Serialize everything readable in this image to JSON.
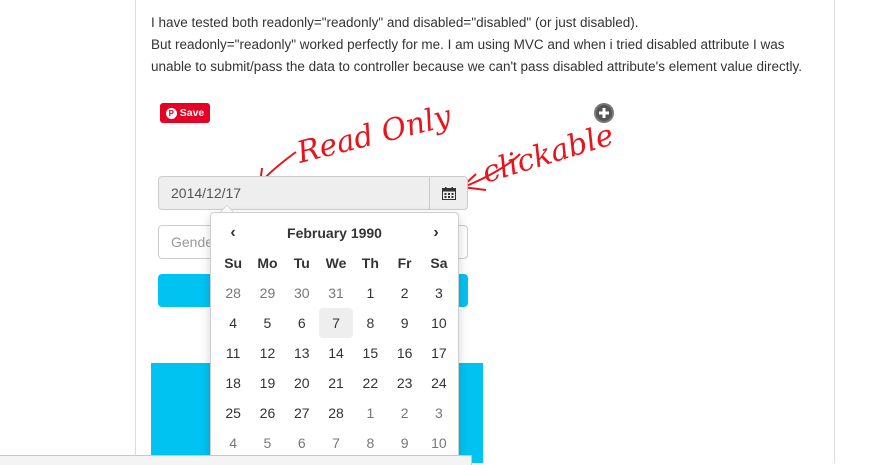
{
  "article": {
    "paragraph1": "I have tested both readonly=\"readonly\" and disabled=\"disabled\" (or just disabled).",
    "paragraph2": "But readonly=\"readonly\" worked perfectly for me. I am using MVC and when i tried disabled attribute I was unable to submit/pass the data to controller because we can't pass disabled attribute's element value directly."
  },
  "pinterest": {
    "label": "Save",
    "logo": "P"
  },
  "annotations": {
    "read_only": "Read Only",
    "clickable": "clickable"
  },
  "form": {
    "date_value": "2014/12/17",
    "gender_placeholder": "Gender",
    "calendar_icon": "calendar-icon"
  },
  "datepicker": {
    "prev": "‹",
    "next": "›",
    "title": "February 1990",
    "weekdays": [
      "Su",
      "Mo",
      "Tu",
      "We",
      "Th",
      "Fr",
      "Sa"
    ],
    "weeks": [
      [
        {
          "d": "28",
          "o": true
        },
        {
          "d": "29",
          "o": true
        },
        {
          "d": "30",
          "o": true
        },
        {
          "d": "31",
          "o": true
        },
        {
          "d": "1"
        },
        {
          "d": "2"
        },
        {
          "d": "3"
        }
      ],
      [
        {
          "d": "4"
        },
        {
          "d": "5"
        },
        {
          "d": "6"
        },
        {
          "d": "7",
          "hl": true
        },
        {
          "d": "8"
        },
        {
          "d": "9"
        },
        {
          "d": "10"
        }
      ],
      [
        {
          "d": "11"
        },
        {
          "d": "12"
        },
        {
          "d": "13"
        },
        {
          "d": "14"
        },
        {
          "d": "15"
        },
        {
          "d": "16"
        },
        {
          "d": "17"
        }
      ],
      [
        {
          "d": "18"
        },
        {
          "d": "19"
        },
        {
          "d": "20"
        },
        {
          "d": "21"
        },
        {
          "d": "22"
        },
        {
          "d": "23"
        },
        {
          "d": "24"
        }
      ],
      [
        {
          "d": "25"
        },
        {
          "d": "26"
        },
        {
          "d": "27"
        },
        {
          "d": "28"
        },
        {
          "d": "1",
          "o": true
        },
        {
          "d": "2",
          "o": true
        },
        {
          "d": "3",
          "o": true
        }
      ],
      [
        {
          "d": "4",
          "o": true
        },
        {
          "d": "5",
          "o": true
        },
        {
          "d": "6",
          "o": true
        },
        {
          "d": "7",
          "o": true
        },
        {
          "d": "8",
          "o": true
        },
        {
          "d": "9",
          "o": true
        },
        {
          "d": "10",
          "o": true
        }
      ]
    ]
  },
  "colors": {
    "accent": "#00c3f2",
    "pinterest": "#e60023",
    "annotation": "#e8141b"
  }
}
